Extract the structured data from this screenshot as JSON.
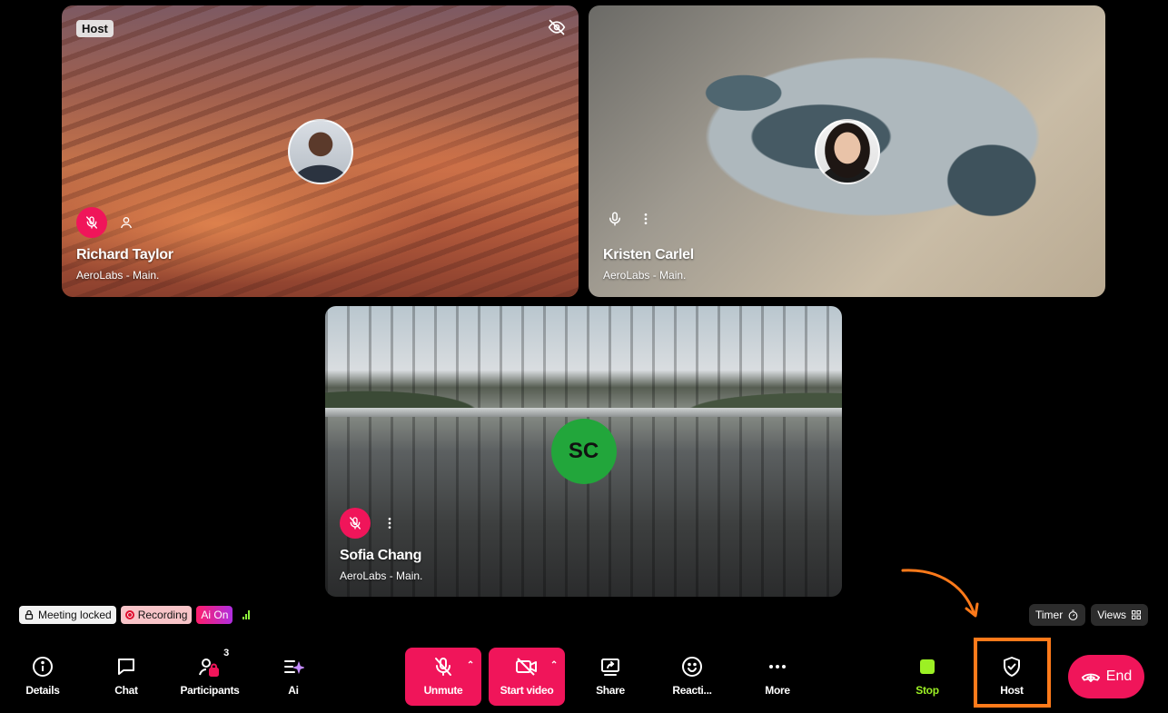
{
  "participants": [
    {
      "name": "Richard Taylor",
      "org": "AeroLabs - Main.",
      "role_tag": "Host"
    },
    {
      "name": "Kristen Carlel",
      "org": "AeroLabs - Main."
    },
    {
      "name": "Sofia Chang",
      "org": "AeroLabs - Main.",
      "initials": "SC"
    }
  ],
  "status": {
    "meeting_locked": "Meeting locked",
    "recording": "Recording",
    "ai": "Ai On"
  },
  "right_pills": {
    "timer": "Timer",
    "views": "Views"
  },
  "toolbar": {
    "details": "Details",
    "chat": "Chat",
    "participants": "Participants",
    "participants_count": "3",
    "ai": "Ai",
    "unmute": "Unmute",
    "start_video": "Start video",
    "share": "Share",
    "reactions": "Reacti...",
    "more": "More",
    "stop": "Stop",
    "host": "Host",
    "end": "End"
  },
  "colors": {
    "accent_red": "#f0155a",
    "stop_green": "#9cf024",
    "highlight_orange": "#ff7a1a",
    "avatar_green": "#22a63b"
  },
  "icons": [
    "mic-off-icon",
    "person-icon",
    "mic-icon",
    "more-vertical-icon",
    "eye-off-icon",
    "lock-icon",
    "signal-icon",
    "timer-icon",
    "grid-icon",
    "info-icon",
    "chat-icon",
    "participants-icon",
    "ai-icon",
    "video-off-icon",
    "share-screen-icon",
    "smile-icon",
    "more-horizontal-icon",
    "shield-check-icon",
    "phone-end-icon"
  ]
}
